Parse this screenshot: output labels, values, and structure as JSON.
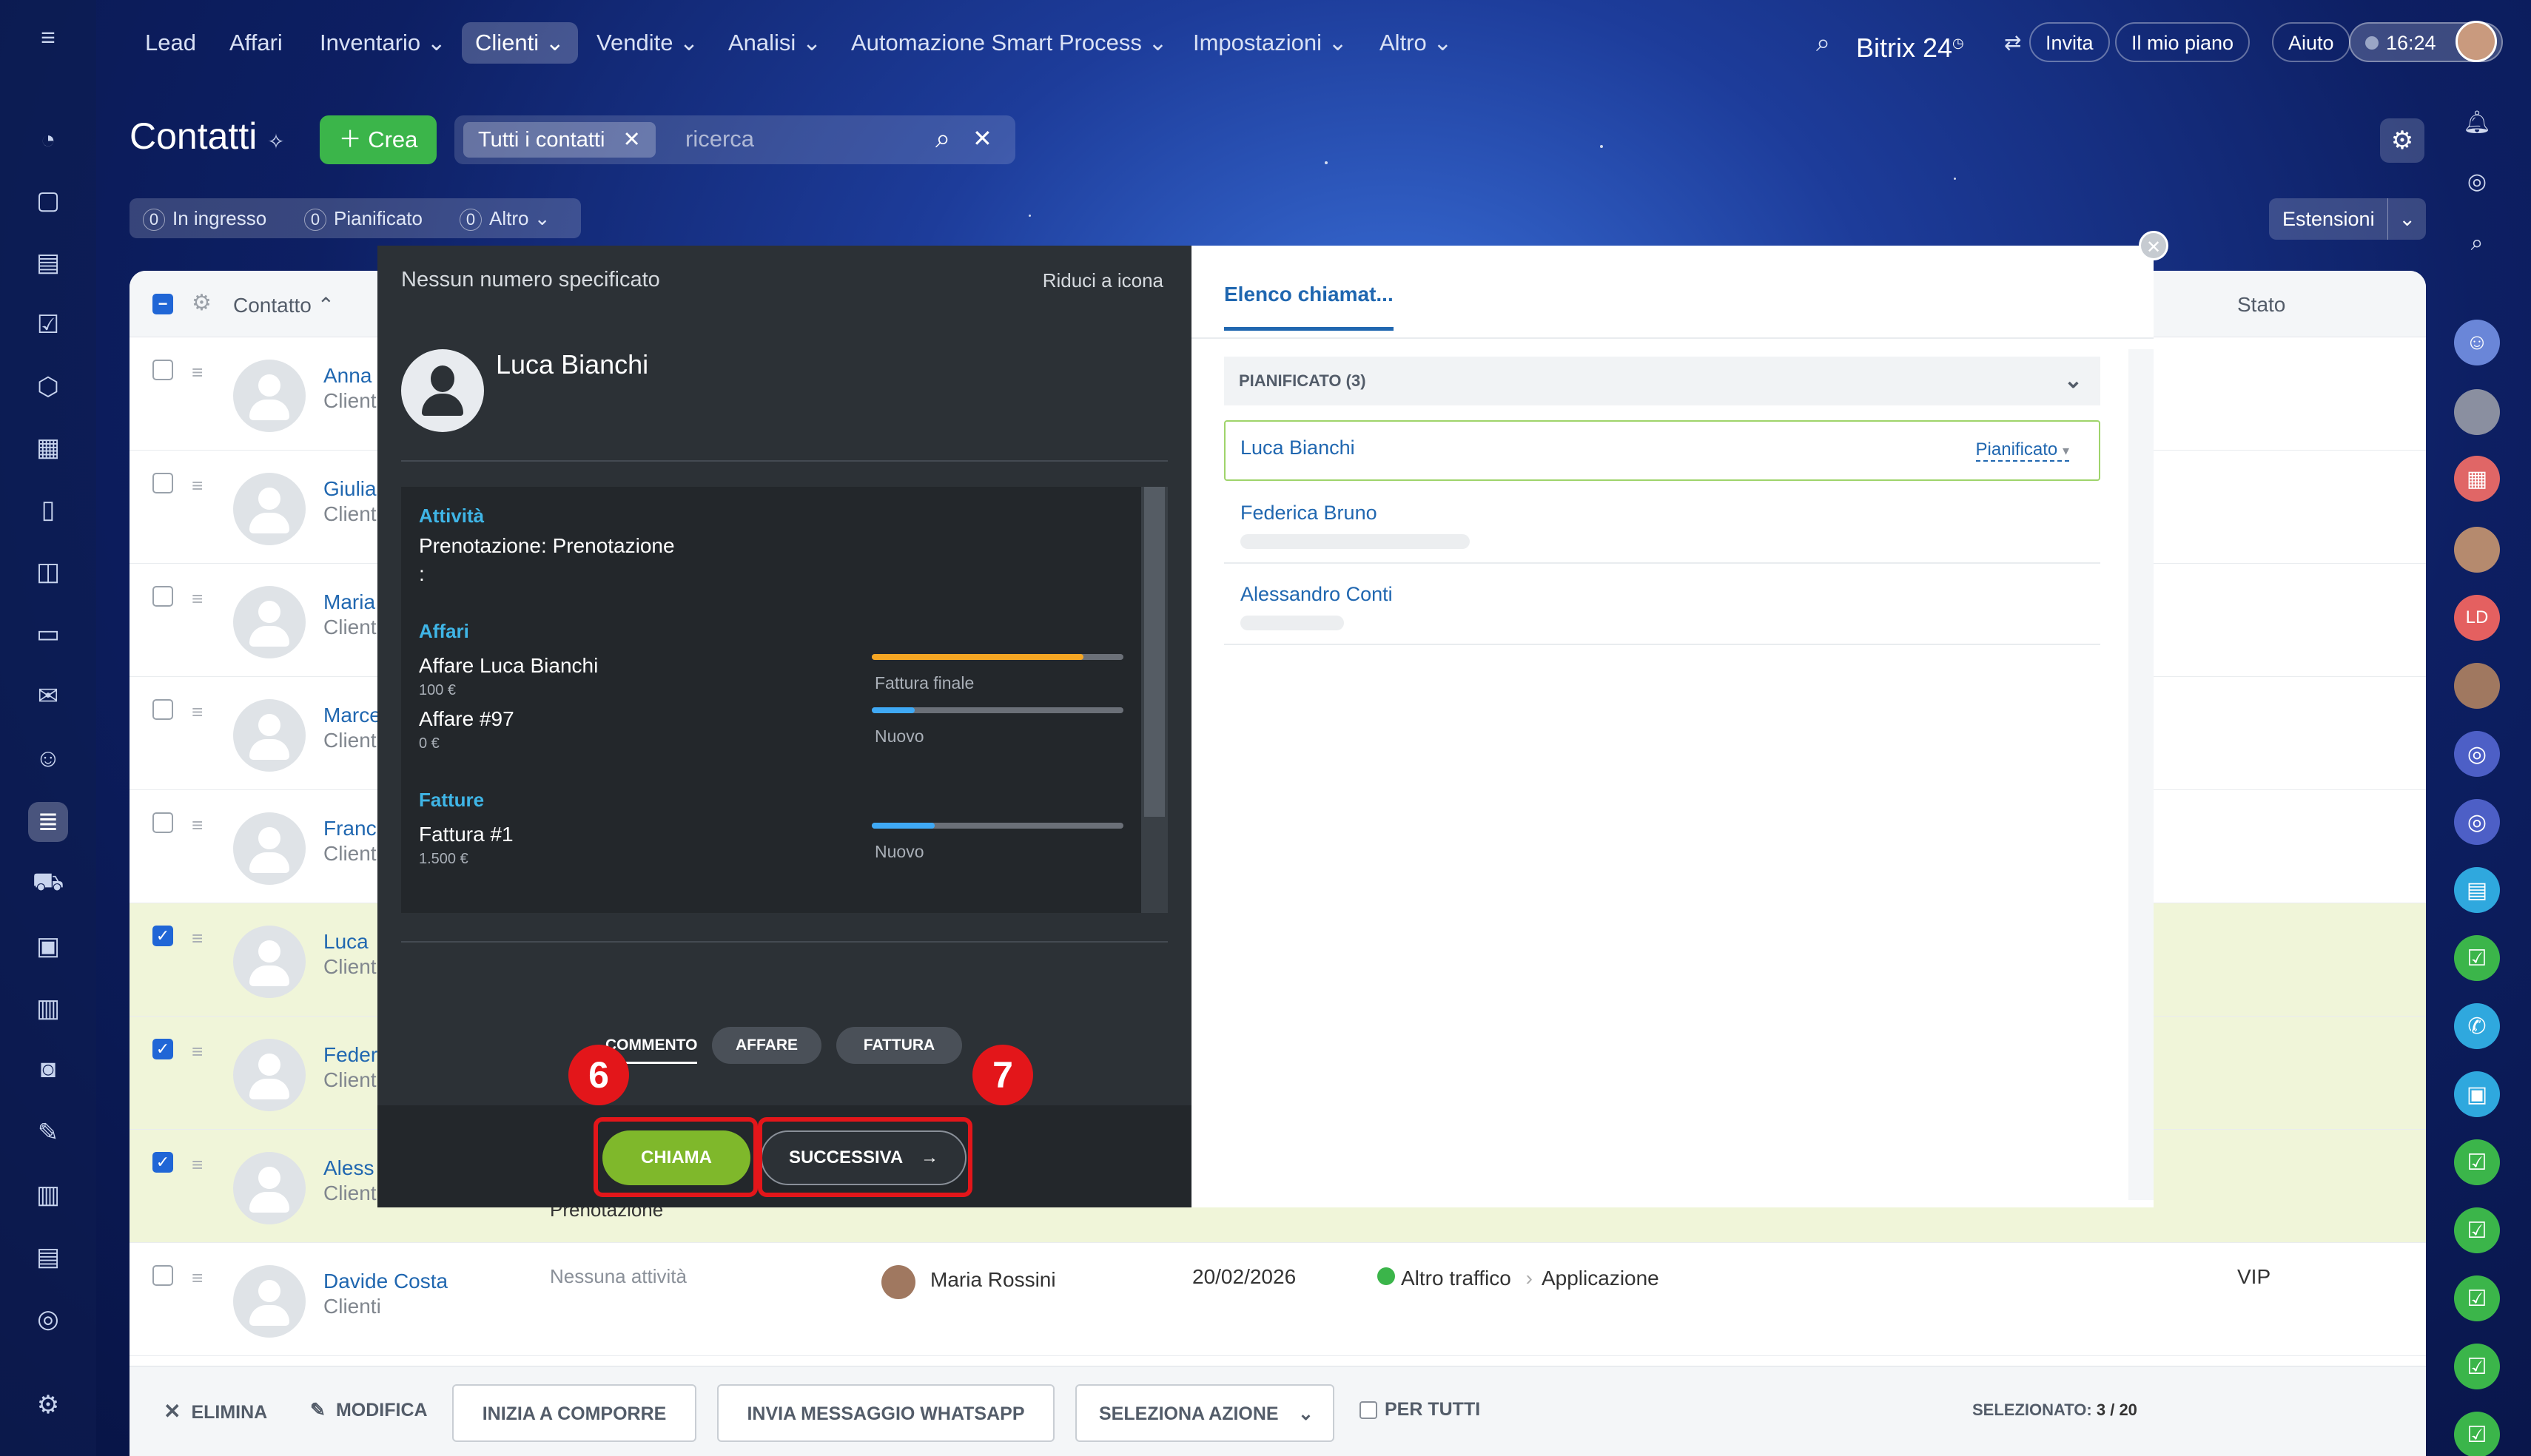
{
  "nav": {
    "items": [
      "Lead",
      "Affari",
      "Inventario",
      "Clienti",
      "Vendite",
      "Analisi",
      "Automazione Smart Process",
      "Impostazioni",
      "Altro"
    ],
    "brand": "Bitrix 24",
    "invite": "Invita",
    "plan": "Il mio piano",
    "help": "Aiuto",
    "time": "16:24"
  },
  "header": {
    "title": "Contatti",
    "create": "Crea",
    "filter_chip": "Tutti i contatti",
    "search_placeholder": "ricerca",
    "counters": [
      {
        "count": "0",
        "label": "In ingresso"
      },
      {
        "count": "0",
        "label": "Pianificato"
      },
      {
        "count": "0",
        "label": "Altro"
      }
    ],
    "extensions": "Estensioni"
  },
  "table": {
    "col_contact": "Contatto",
    "col_status": "Stato",
    "rows": [
      {
        "name": "Anna",
        "sub": "Client",
        "checked": false
      },
      {
        "name": "Giulia",
        "sub": "Client",
        "checked": false
      },
      {
        "name": "Maria",
        "sub": "Client",
        "checked": false
      },
      {
        "name": "Marce",
        "sub": "Client",
        "checked": false
      },
      {
        "name": "Franc",
        "sub": "Client",
        "checked": false
      },
      {
        "name": "Luca",
        "sub": "Client",
        "checked": true
      },
      {
        "name": "Feder",
        "sub": "Client",
        "checked": true
      },
      {
        "name": "Aless",
        "sub": "Client",
        "checked": true
      },
      {
        "name": "Davide Costa",
        "sub": "Clienti",
        "checked": false
      }
    ],
    "peek_text": "Prenotazione",
    "last_row": {
      "activity": "Nessuna attività",
      "responsible": "Maria Rossini",
      "date": "20/02/2026",
      "source": "Altro traffico",
      "source_detail": "Applicazione",
      "status": "VIP"
    }
  },
  "bottom_bar": {
    "delete": "ELIMINA",
    "edit": "MODIFICA",
    "start_dial": "INIZIA A COMPORRE",
    "whatsapp": "INVIA MESSAGGIO WHATSAPP",
    "select_action": "SELEZIONA AZIONE",
    "for_all": "PER TUTTI",
    "selected_label": "SELEZIONATO:",
    "selected_value": "3 / 20"
  },
  "call_panel": {
    "no_number": "Nessun numero specificato",
    "minimize": "Riduci a icona",
    "contact_name": "Luca Bianchi",
    "activity_title": "Attività",
    "activity_text": "Prenotazione: Prenotazione",
    "activity_colon": ":",
    "deals_title": "Affari",
    "deals": [
      {
        "name": "Affare Luca Bianchi",
        "amount": "100 €",
        "stage": "Fattura finale",
        "progress": 0.84
      },
      {
        "name": "Affare #97",
        "amount": "0 €",
        "stage": "Nuovo",
        "progress": 0.17
      }
    ],
    "invoices_title": "Fatture",
    "invoices": [
      {
        "name": "Fattura #1",
        "amount": "1.500 €",
        "stage": "Nuovo",
        "progress": 0.25
      }
    ],
    "tabs": [
      "COMMENTO",
      "AFFARE",
      "FATTURA"
    ],
    "call_button": "CHIAMA",
    "next_button": "SUCCESSIVA",
    "markers": [
      "6",
      "7"
    ]
  },
  "call_list": {
    "tab": "Elenco chiamat...",
    "group": "PIANIFICATO (3)",
    "items": [
      {
        "name": "Luca Bianchi",
        "status": "Pianificato"
      },
      {
        "name": "Federica Bruno"
      },
      {
        "name": "Alessandro Conti"
      }
    ]
  },
  "colors": {
    "accent_green": "#7fb82b",
    "highlight": "#e3161a",
    "link": "#2067b0"
  }
}
